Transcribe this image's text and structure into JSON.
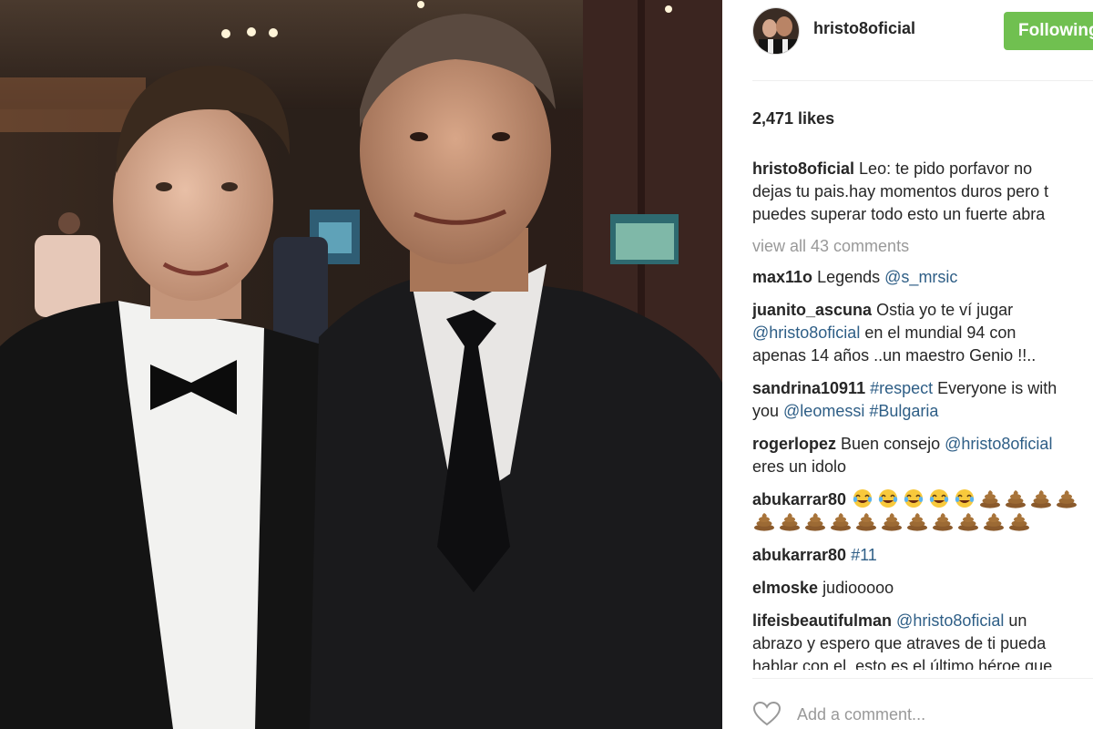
{
  "post": {
    "username": "hristo8oficial",
    "follow_button": "Following",
    "likes": "2,471 likes",
    "caption": {
      "username": "hristo8oficial",
      "lines": [
        "Leo: te pido porfavor no",
        "dejas tu pais.hay momentos duros pero t",
        "puedes superar todo esto un fuerte abra"
      ]
    },
    "view_all": "view all 43 comments",
    "comments": [
      {
        "user": "max11o",
        "lines": [
          [
            {
              "t": "Legends ",
              "m": false
            },
            {
              "t": "@s_mrsic",
              "m": true
            }
          ]
        ]
      },
      {
        "user": "juanito_ascuna",
        "lines": [
          [
            {
              "t": "Ostia yo te ví jugar",
              "m": false
            }
          ],
          [
            {
              "t": "@hristo8oficial",
              "m": true
            },
            {
              "t": " en el mundial 94 con",
              "m": false
            }
          ],
          [
            {
              "t": "apenas 14 años ..un maestro Genio !!..",
              "m": false
            }
          ]
        ]
      },
      {
        "user": "sandrina10911",
        "lines": [
          [
            {
              "t": "#respect",
              "m": true
            },
            {
              "t": " Everyone is with",
              "m": false
            }
          ],
          [
            {
              "t": "you ",
              "m": false
            },
            {
              "t": "@leomessi",
              "m": true
            },
            {
              "t": " ",
              "m": false
            },
            {
              "t": "#Bulgaria",
              "m": true
            }
          ]
        ]
      },
      {
        "user": "rogerlopez",
        "lines": [
          [
            {
              "t": "Buen consejo ",
              "m": false
            },
            {
              "t": "@hristo8oficial",
              "m": true
            }
          ],
          [
            {
              "t": "eres un idolo",
              "m": false
            }
          ]
        ]
      },
      {
        "user": "abukarrar80",
        "emoji_lines": [
          [
            "laugh",
            "laugh",
            "laugh",
            "laugh",
            "laugh",
            "poop",
            "poop",
            "poop",
            "poop"
          ],
          [
            "poop",
            "poop",
            "poop",
            "poop",
            "poop",
            "poop",
            "poop",
            "poop",
            "poop",
            "poop",
            "poop"
          ]
        ]
      },
      {
        "user": "abukarrar80",
        "lines": [
          [
            {
              "t": "#11",
              "m": true
            }
          ]
        ]
      },
      {
        "user": "elmoske",
        "lines": [
          [
            {
              "t": "judiooooo",
              "m": false
            }
          ]
        ]
      },
      {
        "user": "lifeisbeautifulman",
        "lines": [
          [
            {
              "t": "@hristo8oficial",
              "m": true
            },
            {
              "t": " un",
              "m": false
            }
          ],
          [
            {
              "t": "abrazo y espero que atraves de ti pueda",
              "m": false
            }
          ],
          [
            {
              "t": "hablar con el, esto es el último héroe que",
              "m": false
            }
          ]
        ]
      }
    ],
    "add_comment_placeholder": "Add a comment...",
    "colors": {
      "follow_bg": "#70c050",
      "mention": "#2e5e86",
      "muted": "#999999",
      "text": "#262626"
    },
    "icons": {
      "like": "heart-outline-icon",
      "emoji_laugh": "tears-of-joy-emoji",
      "emoji_poop": "pile-of-poo-emoji"
    }
  }
}
